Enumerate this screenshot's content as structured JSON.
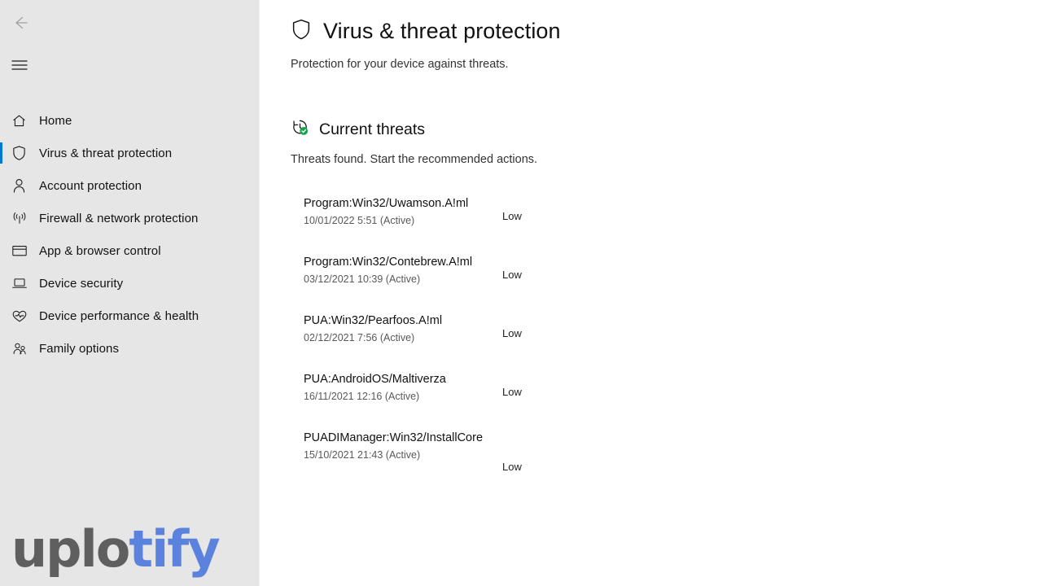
{
  "sidebar": {
    "back_icon": "back-arrow-icon",
    "menu_icon": "hamburger-menu-icon",
    "items": [
      {
        "label": "Home",
        "icon": "home-icon",
        "selected": false
      },
      {
        "label": "Virus & threat protection",
        "icon": "shield-icon",
        "selected": true
      },
      {
        "label": "Account protection",
        "icon": "person-icon",
        "selected": false
      },
      {
        "label": "Firewall & network protection",
        "icon": "wireless-signal-icon",
        "selected": false
      },
      {
        "label": "App & browser control",
        "icon": "browser-window-icon",
        "selected": false
      },
      {
        "label": "Device security",
        "icon": "laptop-icon",
        "selected": false
      },
      {
        "label": "Device performance & health",
        "icon": "heart-pulse-icon",
        "selected": false
      },
      {
        "label": "Family options",
        "icon": "people-group-icon",
        "selected": false
      }
    ],
    "watermark": {
      "part1": "uplo",
      "part2": "tify"
    }
  },
  "main": {
    "title": "Virus & threat protection",
    "title_icon": "shield-icon",
    "subtitle": "Protection for your device against threats.",
    "section": {
      "title": "Current threats",
      "icon": "history-clock-check-icon",
      "subtitle": "Threats found. Start the recommended actions."
    },
    "threats": [
      {
        "name": "Program:Win32/Uwamson.A!ml",
        "time": "10/01/2022 5:51 (Active)",
        "severity": "Low"
      },
      {
        "name": "Program:Win32/Contebrew.A!ml",
        "time": "03/12/2021 10:39 (Active)",
        "severity": "Low"
      },
      {
        "name": "PUA:Win32/Pearfoos.A!ml",
        "time": "02/12/2021 7:56 (Active)",
        "severity": "Low"
      },
      {
        "name": "PUA:AndroidOS/Maltiverza",
        "time": "16/11/2021 12:16 (Active)",
        "severity": "Low"
      },
      {
        "name": "PUADIManager:Win32/InstallCore",
        "time": "15/10/2021 21:43 (Active)",
        "severity": "Low"
      }
    ]
  },
  "colors": {
    "sidebar_bg": "#e6e6e6",
    "accent": "#0078d4",
    "logo_blue": "#5b82dd",
    "logo_gray": "#5f5f5f",
    "badge_green": "#11a44c"
  }
}
